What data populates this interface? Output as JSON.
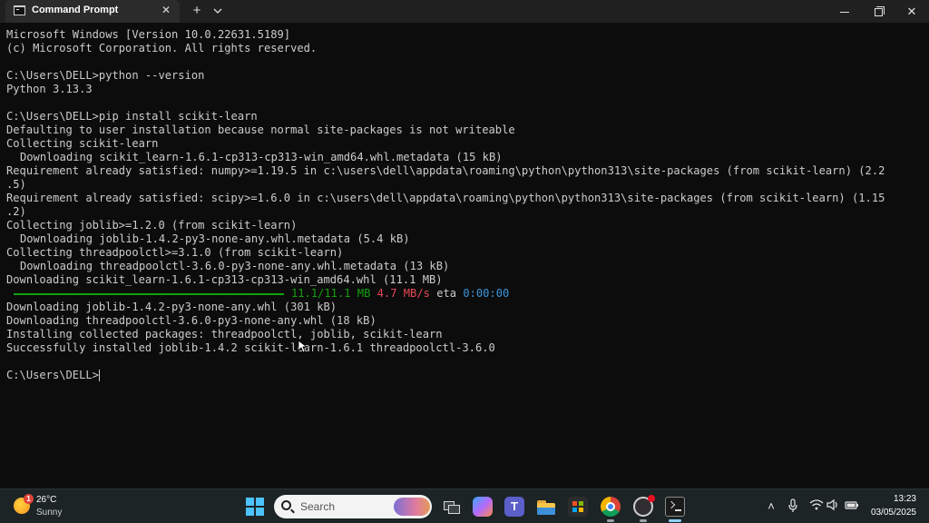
{
  "window": {
    "tab_title": "Command Prompt",
    "tab_icon": "cmd-icon",
    "close_tab_glyph": "✕",
    "new_tab_glyph": "+",
    "minimize_label": "Minimize",
    "maximize_label": "Maximize",
    "close_glyph": "✕"
  },
  "terminal": {
    "lines": [
      "Microsoft Windows [Version 10.0.22631.5189]",
      "(c) Microsoft Corporation. All rights reserved.",
      "",
      "C:\\Users\\DELL>python --version",
      "Python 3.13.3",
      "",
      "C:\\Users\\DELL>pip install scikit-learn",
      "Defaulting to user installation because normal site-packages is not writeable",
      "Collecting scikit-learn",
      "Downloading scikit_learn-1.6.1-cp313-cp313-win_amd64.whl.metadata (15 kB)",
      "Requirement already satisfied: numpy>=1.19.5 in c:\\users\\dell\\appdata\\roaming\\python\\python313\\site-packages (from scikit-learn) (2.2",
      ".5)",
      "Requirement already satisfied: scipy>=1.6.0 in c:\\users\\dell\\appdata\\roaming\\python\\python313\\site-packages (from scikit-learn) (1.15",
      ".2)",
      "Collecting joblib>=1.2.0 (from scikit-learn)",
      "Downloading joblib-1.4.2-py3-none-any.whl.metadata (5.4 kB)",
      "Collecting threadpoolctl>=3.1.0 (from scikit-learn)",
      "Downloading threadpoolctl-3.6.0-py3-none-any.whl.metadata (13 kB)",
      "Downloading scikit_learn-1.6.1-cp313-cp313-win_amd64.whl (11.1 MB)",
      "",
      "Downloading joblib-1.4.2-py3-none-any.whl (301 kB)",
      "Downloading threadpoolctl-3.6.0-py3-none-any.whl (18 kB)",
      "Installing collected packages: threadpoolctl, joblib, scikit-learn",
      "Successfully installed joblib-1.4.2 scikit-learn-1.6.1 threadpoolctl-3.6.0",
      "",
      "C:\\Users\\DELL>"
    ],
    "progress": {
      "fraction": 1.0,
      "size_text": "11.1/11.1 MB",
      "speed_text": "4.7 MB/s",
      "eta_label": "eta",
      "eta_value": "0:00:00"
    },
    "colors": {
      "text": "#cccccc",
      "progress": "#13a10e",
      "speed": "#e74856",
      "eta": "#3a96dd",
      "background": "#0c0c0c"
    }
  },
  "taskbar": {
    "weather": {
      "temp": "26°C",
      "condition": "Sunny",
      "badge": "1",
      "icon": "sun-icon"
    },
    "search_placeholder": "Search",
    "pinned": [
      "start-icon",
      "task-view-icon",
      "copilot-icon",
      "teams-icon",
      "file-explorer-icon",
      "store-icon",
      "chrome-icon",
      "obs-icon",
      "terminal-icon"
    ],
    "tray": {
      "chevron": "˄",
      "mic": "🎙",
      "wifi": "📶",
      "volume": "🔊",
      "battery": "🔋"
    },
    "clock": {
      "time": "13:23",
      "date": "03/05/2025"
    }
  }
}
